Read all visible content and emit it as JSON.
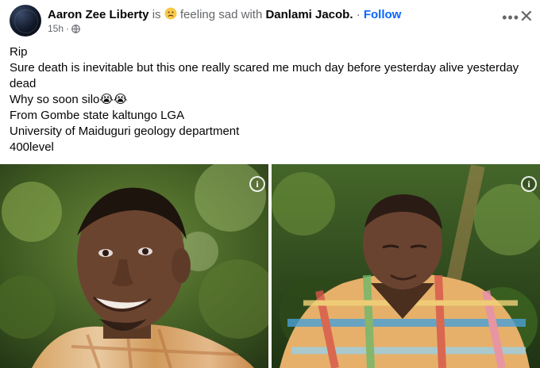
{
  "post": {
    "author": "Aaron Zee Liberty",
    "is_word": "is",
    "feeling_text": "feeling sad with",
    "tagged": "Danlami Jacob.",
    "separator": "·",
    "follow_label": "Follow",
    "time": "15h",
    "time_sep": "·",
    "more_icon": "more-horizontal-icon",
    "close_icon": "close-icon",
    "audience_icon": "globe-icon",
    "lines": [
      "Rip",
      "Sure death is inevitable but this one really scared me much day before yesterday alive yesterday",
      "dead",
      "Why so soon silo😭😭",
      "From Gombe state kaltungo LGA",
      "University of Maiduguri geology department",
      "400level"
    ]
  },
  "photos": [
    {
      "info_icon": "info-icon",
      "info_glyph": "i"
    },
    {
      "info_icon": "info-icon",
      "info_glyph": "i"
    }
  ],
  "colors": {
    "follow": "#0866ff",
    "muted": "#65676b",
    "text": "#050505"
  }
}
